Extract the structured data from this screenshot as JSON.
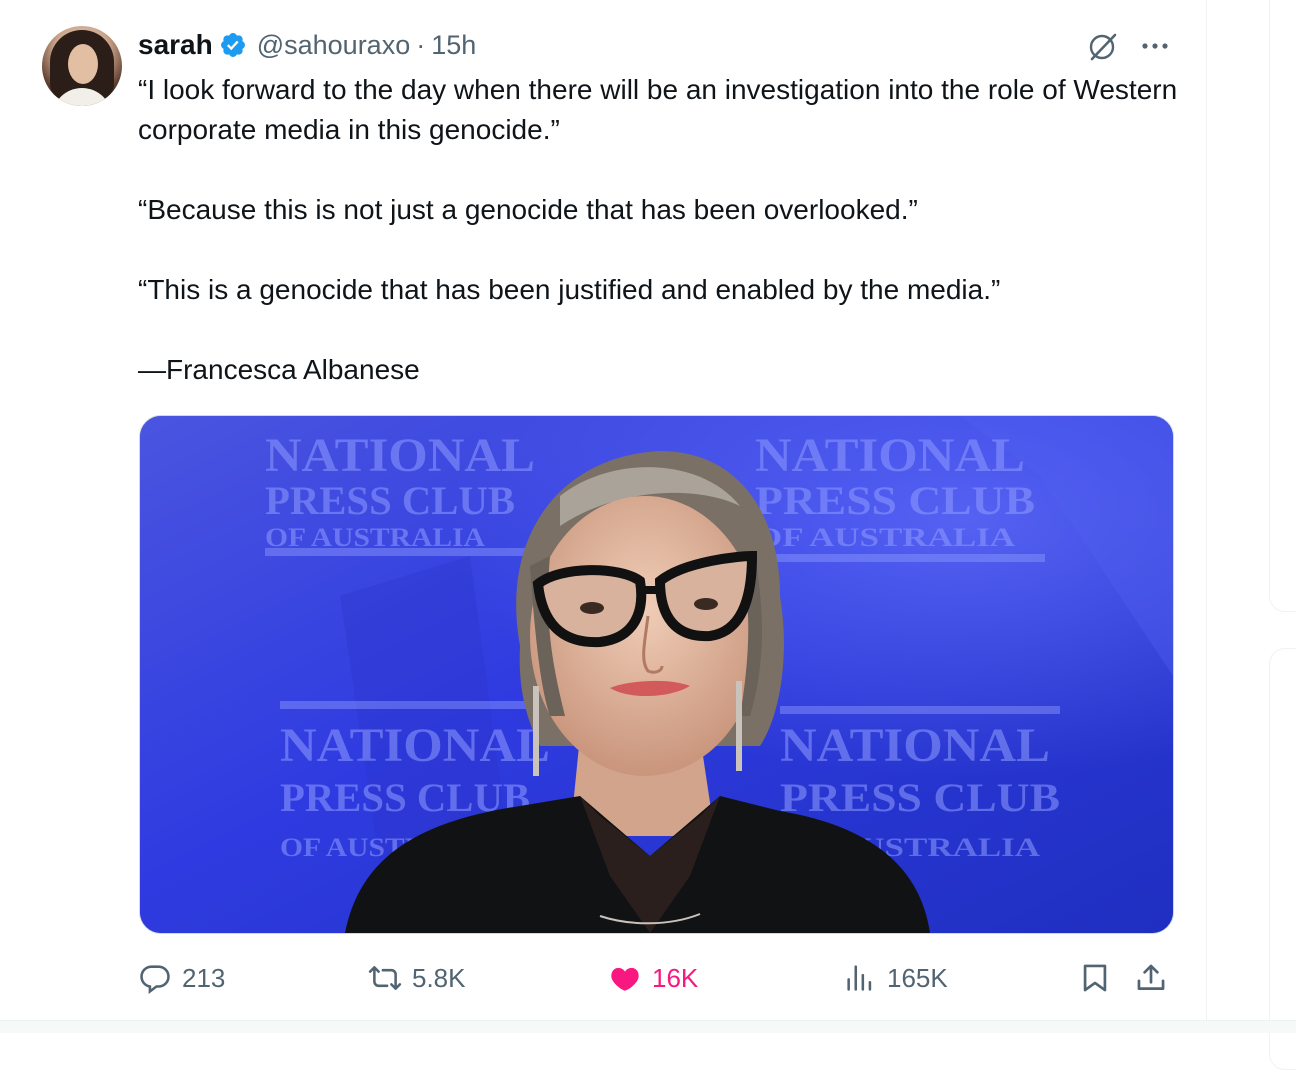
{
  "tweet": {
    "display_name": "sarah",
    "handle": "@sahouraxo",
    "separator": "·",
    "time": "15h",
    "paragraphs": [
      "“I look forward to the day when there will be an investigation into the role of Western corporate media in this genocide.”",
      "“Because this is not just a genocide that has been overlooked.”",
      "“This is a genocide that has been justified and enabled by the media.”",
      "—Francesca Albanese"
    ],
    "media": {
      "backdrop_text": [
        "NATIONAL",
        "PRESS CLUB",
        "OF AUSTRALIA"
      ]
    }
  },
  "actions": {
    "replies": "213",
    "reposts": "5.8K",
    "likes": "16K",
    "views": "165K"
  },
  "icons": {
    "verified": "verified-badge-icon",
    "grok": "grok-icon",
    "more": "more-icon",
    "reply": "reply-icon",
    "repost": "repost-icon",
    "like": "heart-icon",
    "views": "analytics-icon",
    "bookmark": "bookmark-icon",
    "share": "share-icon"
  },
  "colors": {
    "text": "#0f1419",
    "secondary": "#536471",
    "verified": "#1d9bf0",
    "like": "#f91880",
    "border": "#eff3f4"
  }
}
